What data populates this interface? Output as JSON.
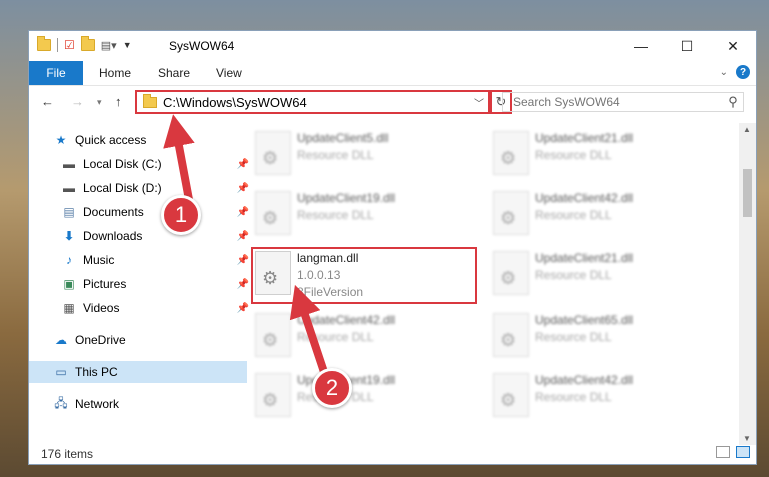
{
  "window": {
    "title": "SysWOW64",
    "controls": {
      "minimize": "—",
      "maximize": "☐",
      "close": "✕"
    }
  },
  "ribbon": {
    "tabs": [
      "File",
      "Home",
      "Share",
      "View"
    ],
    "help": "?"
  },
  "nav": {
    "address": "C:\\Windows\\SysWOW64",
    "search_placeholder": "Search SysWOW64"
  },
  "sidebar": {
    "items": [
      {
        "label": "Quick access",
        "icon": "star-icon"
      },
      {
        "label": "Local Disk (C:)",
        "icon": "drive-icon",
        "pinned": true
      },
      {
        "label": "Local Disk (D:)",
        "icon": "drive-icon",
        "pinned": true
      },
      {
        "label": "Documents",
        "icon": "documents-icon",
        "pinned": true
      },
      {
        "label": "Downloads",
        "icon": "download-icon",
        "pinned": true
      },
      {
        "label": "Music",
        "icon": "music-icon",
        "pinned": true
      },
      {
        "label": "Pictures",
        "icon": "pictures-icon",
        "pinned": true
      },
      {
        "label": "Videos",
        "icon": "videos-icon",
        "pinned": true
      },
      {
        "label": "OneDrive",
        "icon": "cloud-icon"
      },
      {
        "label": "This PC",
        "icon": "computer-icon",
        "selected": true
      },
      {
        "label": "Network",
        "icon": "network-icon"
      }
    ]
  },
  "files": [
    {
      "name": "UpdateClient5.dll",
      "type": "Resource DLL"
    },
    {
      "name": "UpdateClient21.dll",
      "type": "Resource DLL"
    },
    {
      "name": "UpdateClient19.dll",
      "type": "Resource DLL"
    },
    {
      "name": "UpdateClient42.dll",
      "type": "Resource DLL"
    },
    {
      "name": "langman.dll",
      "version": "1.0.0.13",
      "type": "8FileVersion"
    },
    {
      "name": "UpdateClient21.dll",
      "type": "Resource DLL"
    },
    {
      "name": "UpdateClient42.dll",
      "type": "Resource DLL"
    },
    {
      "name": "UpdateClient65.dll",
      "type": "Resource DLL"
    },
    {
      "name": "UpdateClient19.dll",
      "type": "Resource DLL"
    },
    {
      "name": "UpdateClient42.dll",
      "type": "Resource DLL"
    }
  ],
  "status": {
    "item_count": "176 items"
  },
  "annotations": {
    "badge1": "1",
    "badge2": "2",
    "color": "#d9383f"
  }
}
